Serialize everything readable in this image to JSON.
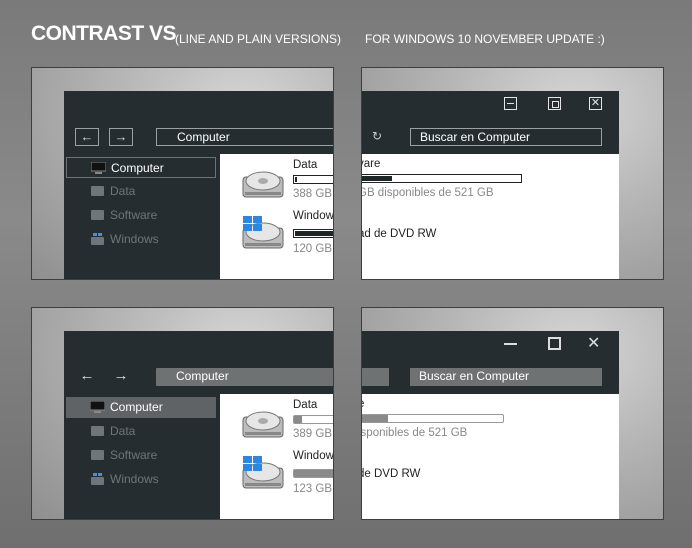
{
  "header": {
    "title": "CONTRAST VS",
    "subtitle": "(LINE AND PLAIN VERSIONS)",
    "right_text": "FOR WINDOWS 10 NOVEMBER UPDATE :)"
  },
  "colors": {
    "window_bg": "#252d31",
    "plain_field": "#6f7273",
    "bar_fill_line": "#1f2628",
    "bar_fill_plain": "#8a8a8a"
  },
  "explorer": {
    "address": "Computer",
    "search": "Buscar en Computer",
    "sidebar": [
      "Computer",
      "Data",
      "Software",
      "Windows"
    ],
    "line": {
      "drive_data_name": "Data",
      "drive_data_size": "388 GB",
      "drive_data_used": 0.02,
      "drive_win_name": "Window",
      "drive_win_size": "120 GB",
      "drive_win_used": 0.98,
      "software_partial": "vare",
      "software_info": "GB disponibles de 521 GB",
      "software_used": 0.2,
      "dvd_label": "ad de DVD RW"
    },
    "plain": {
      "drive_data_name": "Data",
      "drive_data_size": "389 GB",
      "drive_data_used": 0.08,
      "drive_win_name": "Window",
      "drive_win_size": "123 GB",
      "drive_win_used": 0.97,
      "software_partial": "e",
      "software_info": "isponibles de 521 GB",
      "software_used": 0.2,
      "dvd_label": "de DVD RW"
    }
  }
}
